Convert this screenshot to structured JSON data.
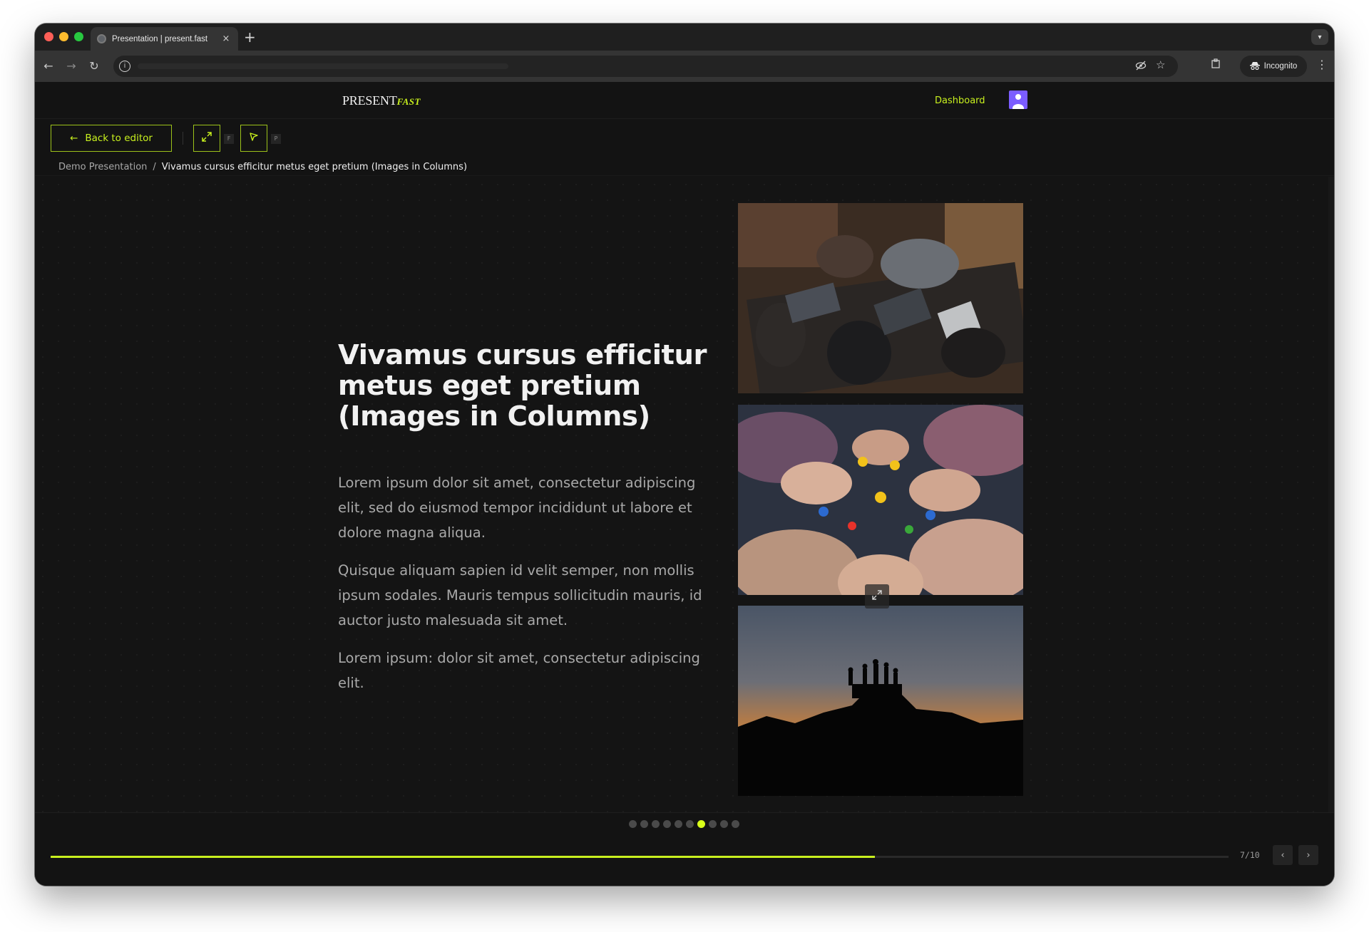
{
  "browser": {
    "tab_title": "Presentation | present.fast",
    "tab_close": "×",
    "new_tab": "+",
    "incognito_label": "Incognito"
  },
  "app": {
    "logo_main": "PRESENT",
    "logo_accent": "FAST",
    "dashboard_link": "Dashboard",
    "accent_color": "#c8f01e"
  },
  "controls": {
    "back_label": "Back to editor",
    "fullscreen_key": "F",
    "pointer_key": "P"
  },
  "breadcrumb": {
    "presentation": "Demo Presentation",
    "separator": "/",
    "slide": "Vivamus cursus efficitur metus eget pretium (Images in Columns)"
  },
  "slide": {
    "title": "Vivamus cursus efficitur metus eget pretium (Images in Columns)",
    "paragraphs": [
      "Lorem ipsum dolor sit amet, consectetur adipiscing elit, sed do eiusmod tempor incididunt ut labore et dolore magna aliqua.",
      "Quisque aliquam sapien id velit semper, non mollis ipsum sodales. Mauris tempus sollicitudin mauris, id auctor justo malesuada sit amet.",
      "Lorem ipsum: dolor sit amet, consectetur adipiscing elit."
    ],
    "images": [
      "team-working-at-laptops-photo",
      "hands-holding-lego-figures-photo",
      "silhouettes-on-mountain-sunset-photo"
    ]
  },
  "footer": {
    "total_slides": 10,
    "current_slide": 7,
    "page_counter": "7/10",
    "progress_fraction": 0.7
  }
}
